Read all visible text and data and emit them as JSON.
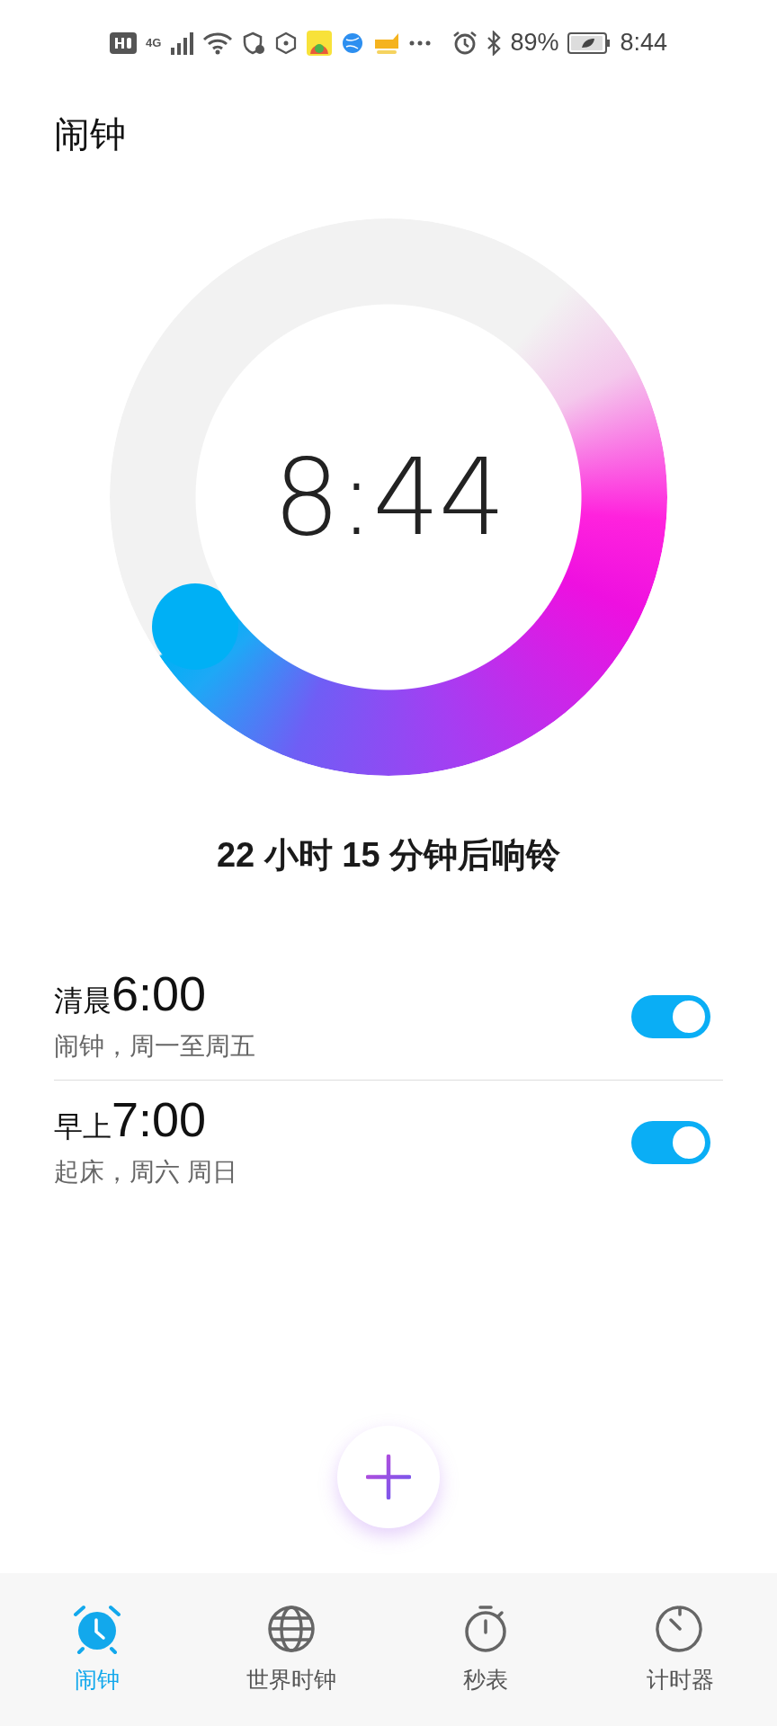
{
  "status_bar": {
    "network": "4G",
    "battery": "89%",
    "time": "8:44"
  },
  "title": "闹钟",
  "clock": {
    "time": "8:44"
  },
  "countdown": "22 小时 15 分钟后响铃",
  "alarms": [
    {
      "period": "清晨",
      "time": "6:00",
      "detail": "闹钟，周一至周五",
      "on": true
    },
    {
      "period": "早上",
      "time": "7:00",
      "detail": "起床，周六 周日",
      "on": true
    }
  ],
  "tabs": [
    {
      "kind": "alarm",
      "label": "闹钟",
      "selected": true
    },
    {
      "kind": "globe",
      "label": "世界时钟",
      "selected": false
    },
    {
      "kind": "stopwatch",
      "label": "秒表",
      "selected": false
    },
    {
      "kind": "timer",
      "label": "计时器",
      "selected": false
    }
  ]
}
